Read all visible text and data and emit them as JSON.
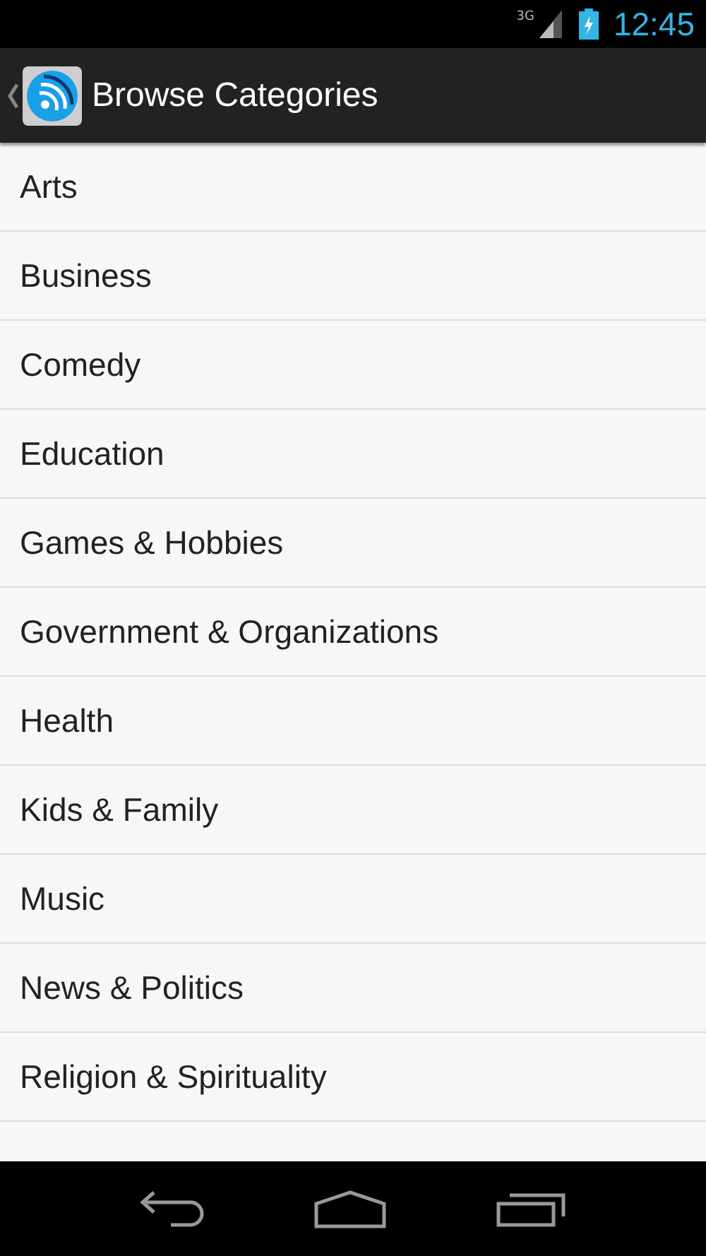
{
  "status_bar": {
    "network": "3G",
    "time": "12:45"
  },
  "action_bar": {
    "title": "Browse Categories"
  },
  "categories": [
    {
      "label": "Arts"
    },
    {
      "label": "Business"
    },
    {
      "label": "Comedy"
    },
    {
      "label": "Education"
    },
    {
      "label": "Games & Hobbies"
    },
    {
      "label": "Government & Organizations"
    },
    {
      "label": "Health"
    },
    {
      "label": "Kids & Family"
    },
    {
      "label": "Music"
    },
    {
      "label": "News & Politics"
    },
    {
      "label": "Religion & Spirituality"
    }
  ]
}
